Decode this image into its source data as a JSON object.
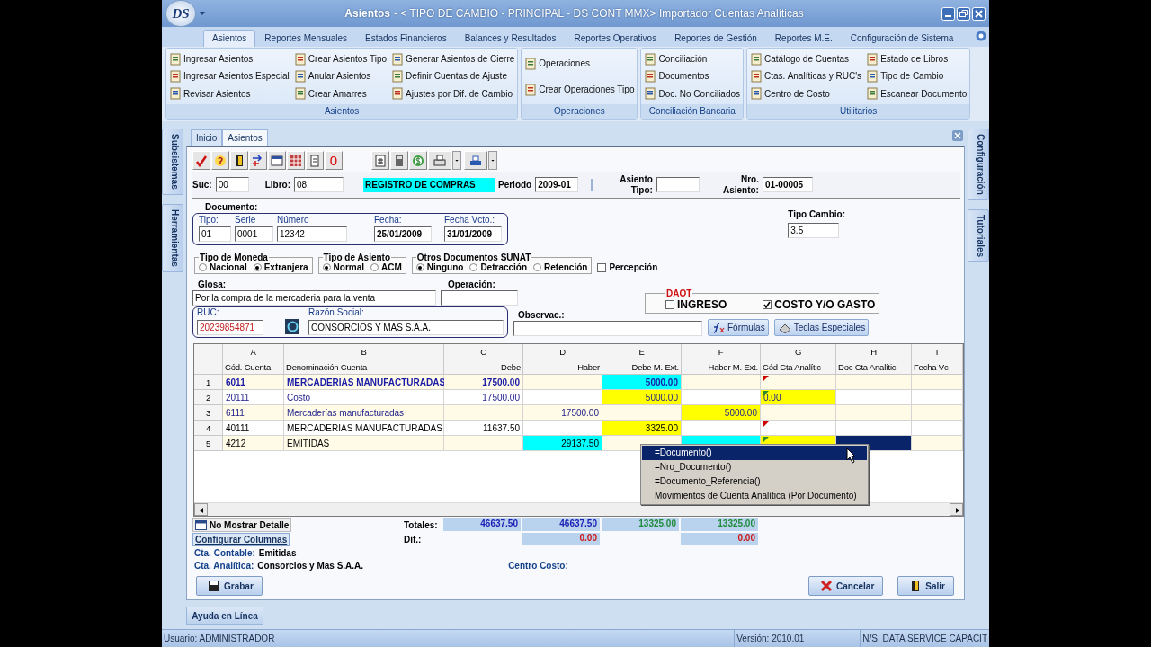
{
  "window": {
    "logo": "DS",
    "title": "Asientos",
    "subtitle": "- < TIPO DE CAMBIO - PRINCIPAL - DS CONT MMX> Importador Cuentas Analíticas"
  },
  "ribbon": {
    "tabs": [
      {
        "label": "Asientos",
        "selected": true
      },
      {
        "label": "Reportes Mensuales",
        "selected": false
      },
      {
        "label": "Estados Financieros",
        "selected": false
      },
      {
        "label": "Balances y Resultados",
        "selected": false
      },
      {
        "label": "Reportes Operativos",
        "selected": false
      },
      {
        "label": "Reportes de Gestión",
        "selected": false
      },
      {
        "label": "Reportes M.E.",
        "selected": false
      },
      {
        "label": "Configuración de Sistema",
        "selected": false
      }
    ],
    "groups": [
      {
        "label": "Asientos",
        "columns": [
          [
            "Ingresar Asientos",
            "Ingresar Asientos Especial",
            "Revisar Asientos"
          ],
          [
            "Crear Asientos Tipo",
            "Anular Asientos",
            "Crear Amarres"
          ],
          [
            "Generar Asientos de Cierre",
            "Definir Cuentas de Ajuste",
            "Ajustes por Dif. de Cambio"
          ]
        ]
      },
      {
        "label": "Operaciones",
        "columns": [
          [
            "Operaciones",
            "Crear Operaciones Tipo"
          ]
        ]
      },
      {
        "label": "Conciliación Bancaria",
        "columns": [
          [
            "Conciliación",
            "Documentos",
            "Doc. No Conciliados"
          ]
        ]
      },
      {
        "label": "Utilitarios",
        "columns": [
          [
            "Catálogo de Cuentas",
            "Ctas. Analíticas y RUC's",
            "Centro de Costo"
          ],
          [
            "Estado de Libros",
            "Tipo de Cambio",
            "Escanear Documento"
          ]
        ]
      }
    ]
  },
  "left_tabs": [
    "Subsistemas",
    "Herramientas"
  ],
  "right_tabs": [
    "Configuración",
    "Tutoriales"
  ],
  "doc_tabs": [
    {
      "label": "Inicio",
      "selected": false
    },
    {
      "label": "Asientos",
      "selected": true
    }
  ],
  "toolbar": {
    "counter": "0"
  },
  "header": {
    "suc": {
      "label": "Suc:",
      "value": "00"
    },
    "libro": {
      "label": "Libro:",
      "value": "08"
    },
    "book_name": "REGISTRO DE COMPRAS",
    "periodo": {
      "label": "Periodo",
      "value": "2009-01"
    },
    "asiento_tipo": {
      "label": [
        "Asiento",
        "Tipo:"
      ]
    },
    "nro_asiento": {
      "label": [
        "Nro.",
        "Asiento:"
      ],
      "value": "01-00005"
    }
  },
  "documento": {
    "title": "Documento:",
    "fields": [
      {
        "label": "Tipo:",
        "value": "01",
        "kind": "text"
      },
      {
        "label": "Serie",
        "value": "0001",
        "kind": "text"
      },
      {
        "label": "Número",
        "value": "12342",
        "kind": "text"
      },
      {
        "label": "Fecha:",
        "value": "25/01/2009",
        "kind": "date"
      },
      {
        "label": "Fecha Vcto.:",
        "value": "31/01/2009",
        "kind": "date"
      }
    ]
  },
  "tipo_cambio": {
    "label": "Tipo Cambio:",
    "value": "3.5"
  },
  "option_groups": [
    {
      "title": "Tipo de Moneda",
      "options": [
        {
          "label": "Nacional",
          "selected": false
        },
        {
          "label": "Extranjera",
          "selected": true
        }
      ]
    },
    {
      "title": "Tipo de Asiento",
      "options": [
        {
          "label": "Normal",
          "selected": true
        },
        {
          "label": "ACM",
          "selected": false
        }
      ]
    },
    {
      "title": "Otros Documentos SUNAT",
      "options": [
        {
          "label": "Ninguno",
          "selected": true
        },
        {
          "label": "Detracción",
          "selected": false
        },
        {
          "label": "Retención",
          "selected": false
        }
      ]
    }
  ],
  "percepcion": {
    "label": "Percepción",
    "checked": false
  },
  "glosa": {
    "label": "Glosa:",
    "value": "Por la compra de la mercaderia para la venta"
  },
  "operacion": {
    "label": "Operación:"
  },
  "daot": {
    "title": "DAOT",
    "options": [
      {
        "label": "INGRESO",
        "checked": false
      },
      {
        "label": "COSTO Y/O GASTO",
        "checked": true
      }
    ]
  },
  "ruc": {
    "label": "RUC:",
    "value": "20239854871"
  },
  "razon_social": {
    "label": "Razón Social:",
    "value": "CONSORCIOS Y MAS S.A.A."
  },
  "observac": {
    "label": "Observac.:"
  },
  "action_buttons": [
    "Fórmulas",
    "Teclas Especiales"
  ],
  "grid": {
    "columns": [
      {
        "letter": "A",
        "title": "Cód. Cuenta",
        "kind": "text"
      },
      {
        "letter": "B",
        "title": "Denominación Cuenta",
        "kind": "text"
      },
      {
        "letter": "C",
        "title": "Debe",
        "kind": "amount"
      },
      {
        "letter": "D",
        "title": "Haber",
        "kind": "amount"
      },
      {
        "letter": "E",
        "title": "Debe M. Ext.",
        "kind": "amount"
      },
      {
        "letter": "F",
        "title": "Haber M. Ext.",
        "kind": "amount"
      },
      {
        "letter": "G",
        "title": "Cód Cta Analític",
        "kind": "text"
      },
      {
        "letter": "H",
        "title": "Doc Cta Analític",
        "kind": "text"
      },
      {
        "letter": "I",
        "title": "Fecha Vc",
        "kind": "text"
      }
    ],
    "rows": [
      {
        "number": "1",
        "kind": "bold",
        "cells": [
          {
            "text": "6011"
          },
          {
            "text": "MERCADERIAS MANUFACTURADAS"
          },
          {
            "text": "17500.00"
          },
          {},
          {
            "text": "5000.00",
            "color": "#00ffff"
          },
          {},
          {
            "flag": {
              "color": "#cc0000"
            }
          },
          {},
          {}
        ]
      },
      {
        "number": "2",
        "kind": "blue",
        "cells": [
          {
            "text": "20111"
          },
          {
            "text": "Costo"
          },
          {
            "text": "17500.00"
          },
          {},
          {
            "text": "5000.00",
            "color": "#ffff00"
          },
          {},
          {
            "text": "0.00",
            "color": "#ffff00",
            "flag": {
              "color": "#2e8b2e"
            }
          },
          {},
          {}
        ]
      },
      {
        "number": "3",
        "kind": "blue",
        "cells": [
          {
            "text": "6111"
          },
          {
            "text": "Mercaderías manufacturadas"
          },
          {},
          {
            "text": "17500.00"
          },
          {},
          {
            "text": "5000.00",
            "color": "#ffff00"
          },
          {},
          {},
          {}
        ]
      },
      {
        "number": "4",
        "kind": "normal",
        "cells": [
          {
            "text": "40111"
          },
          {
            "text": "MERCADERIAS MANUFACTURADAS"
          },
          {
            "text": "11637.50"
          },
          {},
          {
            "text": "3325.00",
            "color": "#ffff00"
          },
          {},
          {
            "flag": {
              "color": "#cc0000"
            }
          },
          {},
          {}
        ]
      },
      {
        "number": "5",
        "kind": "normal",
        "cells": [
          {
            "text": "4212"
          },
          {
            "text": "EMITIDAS"
          },
          {},
          {
            "text": "29137.50",
            "color": "#00ffff"
          },
          {},
          {
            "color": "#00ffff"
          },
          {
            "color": "#ffff00",
            "flag": {
              "color": "#2e8b2e"
            }
          },
          {
            "color": "#0a246a"
          },
          {}
        ]
      }
    ]
  },
  "context_menu": [
    {
      "label": "=Documento()",
      "selected": true
    },
    {
      "label": "=Nro_Documento()",
      "selected": false
    },
    {
      "label": "=Documento_Referencia()",
      "selected": false
    },
    {
      "label": "Movimientos de Cuenta Analítica (Por Documento)",
      "selected": false
    }
  ],
  "detail_toggle": "No Mostrar Detalle",
  "configure_columns": "Configurar Columnas",
  "totals": {
    "label": "Totales:",
    "values": [
      {
        "kind": "value",
        "text": "46637.50",
        "color": "#1c1cb4"
      },
      {
        "kind": "value",
        "text": "46637.50",
        "color": "#1c1cb4"
      },
      {
        "kind": "value",
        "text": "13325.00",
        "color": "#1e8a3c"
      },
      {
        "kind": "value",
        "text": "13325.00",
        "color": "#1e8a3c"
      }
    ]
  },
  "dif": {
    "label": "Dif.:",
    "values": [
      {
        "kind": "empty"
      },
      {
        "kind": "value",
        "text": "0.00",
        "color": "#d01818"
      },
      {
        "kind": "empty"
      },
      {
        "kind": "value",
        "text": "0.00",
        "color": "#d01818"
      }
    ]
  },
  "info": [
    {
      "label": "Cta. Contable:",
      "value": "Emitidas"
    },
    {
      "label": "Cta. Analítica:",
      "value": "Consorcios y Mas S.A.A."
    }
  ],
  "centro_costo": {
    "label": "Centro Costo:"
  },
  "buttons": {
    "save": "Grabar",
    "cancel": "Cancelar",
    "exit": "Salir"
  },
  "help": "Ayuda en Línea",
  "status_bar": [
    "Usuario: ADMINISTRADOR",
    "Versión: 2010.01",
    "N/S: DATA SERVICE CAPACIT"
  ]
}
